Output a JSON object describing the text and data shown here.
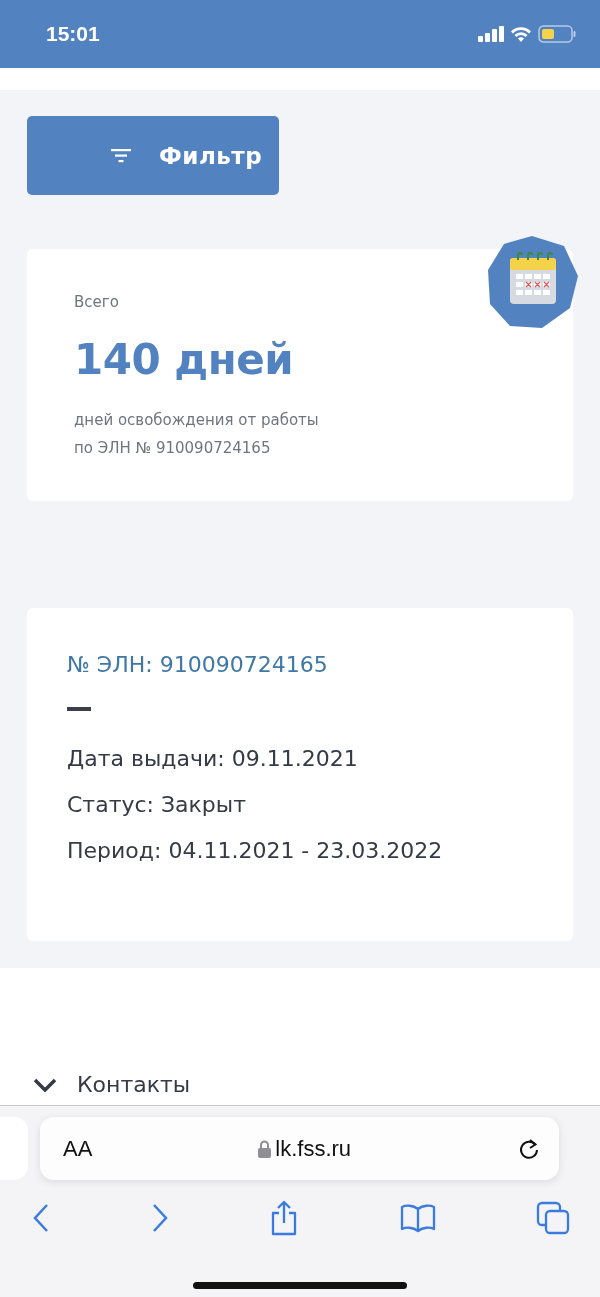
{
  "status_bar": {
    "time": "15:01"
  },
  "filter_button": {
    "label": "Фильтр"
  },
  "summary": {
    "caption": "Всего",
    "total": "140 дней",
    "description": [
      "дней освобождения от работы",
      "по ЭЛН № 910090724165"
    ]
  },
  "document": {
    "number": "№ ЭЛН: 910090724165",
    "fields": [
      "Дата выдачи: 09.11.2021",
      "Статус: Закрыт",
      "Период: 04.11.2021 - 23.03.2022"
    ]
  },
  "contacts": {
    "label": "Контакты"
  },
  "browser": {
    "text_size": "AA",
    "url": "lk.fss.ru"
  }
}
